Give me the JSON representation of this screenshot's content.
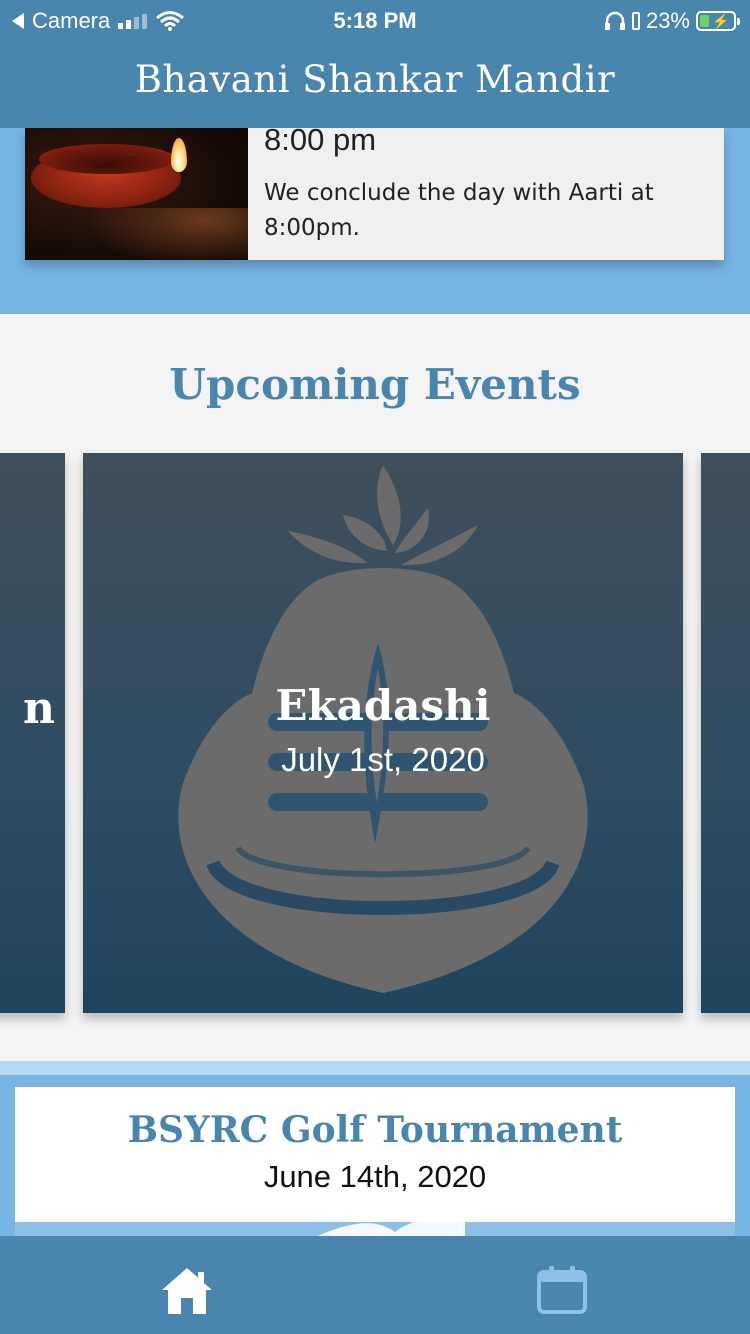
{
  "status_bar": {
    "back_app": "Camera",
    "time": "5:18 PM",
    "battery": "23%"
  },
  "header": {
    "title": "Bhavani Shankar Mandir"
  },
  "schedule_item": {
    "time": "8:00 pm",
    "description": "We conclude the day with Aarti at 8:00pm."
  },
  "events": {
    "section_title": "Upcoming Events",
    "featured": {
      "name": "Ekadashi",
      "date": "July 1st, 2020"
    },
    "left_peek_letter": "n"
  },
  "next_event": {
    "title": "BSYRC Golf Tournament",
    "date": "June 14th, 2020"
  },
  "tabbar": {
    "items": [
      "home-icon",
      "calendar-icon"
    ]
  },
  "colors": {
    "brand_blue": "#4a85ad",
    "light_blue": "#77b5e4"
  }
}
